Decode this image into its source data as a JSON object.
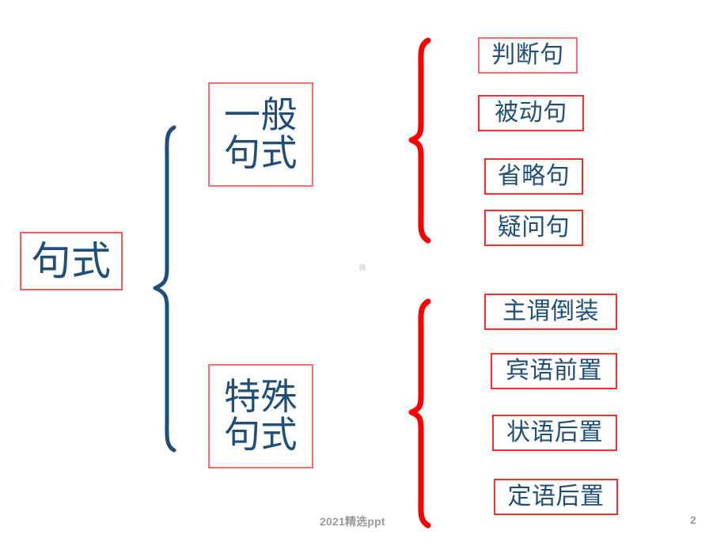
{
  "slide": {
    "page_number": "2",
    "footer_credit": "2021精选ppt",
    "colors": {
      "text_blue": "#1F4E79",
      "border_red": "#FF2B2B",
      "border_red_soft": "#FF6B6B",
      "brace_blue": "#1F4E79",
      "brace_red": "#FF0000",
      "background": "#FFFFFF",
      "footer_gray": "#9A9A9A"
    }
  },
  "diagram": {
    "root": {
      "label": "句式"
    },
    "branches": [
      {
        "label": "一般\n句式",
        "leaves": [
          {
            "label": "判断句"
          },
          {
            "label": "被动句"
          },
          {
            "label": "省略句"
          },
          {
            "label": "疑问句"
          }
        ]
      },
      {
        "label": "特殊\n句式",
        "leaves": [
          {
            "label": "主谓倒装"
          },
          {
            "label": "宾语前置"
          },
          {
            "label": "状语后置"
          },
          {
            "label": "定语后置"
          }
        ]
      }
    ]
  }
}
